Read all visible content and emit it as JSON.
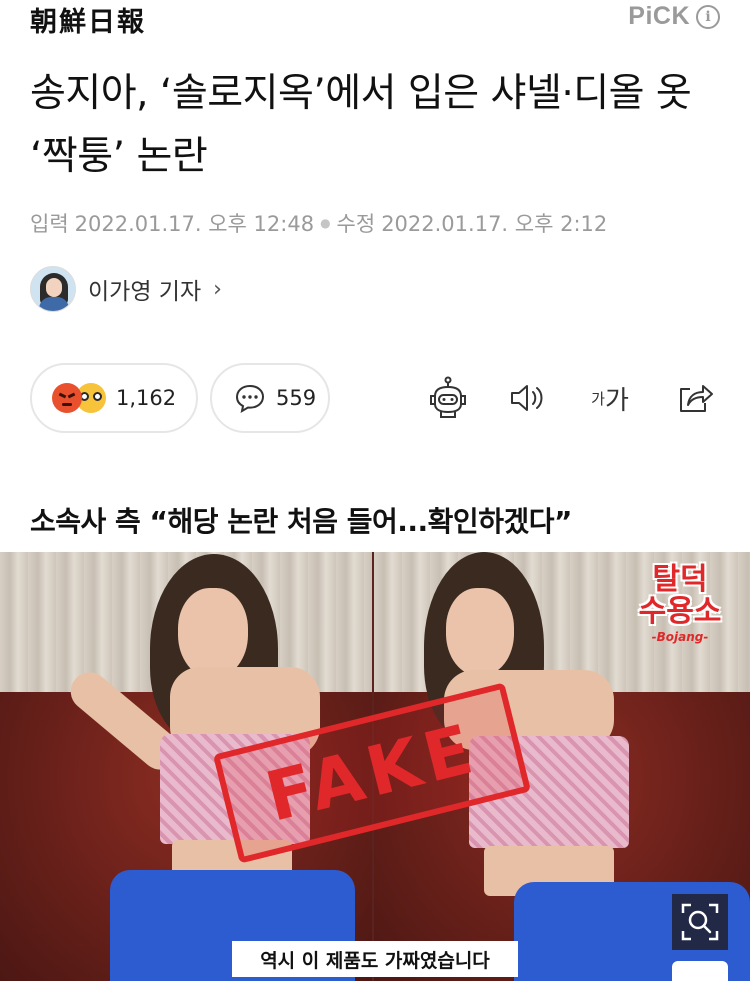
{
  "header": {
    "logo": "朝鮮日報",
    "pick_label": "PiCK",
    "info_icon": "info-icon"
  },
  "article": {
    "title": "송지아, ‘솔로지옥’에서 입은 샤넬·디올 옷 ‘짝퉁’ 논란",
    "published_label": "입력",
    "published_time": "2022.01.17. 오후 12:48",
    "modified_label": "수정",
    "modified_time": "2022.01.17. 오후 2:12",
    "reporter": "이가영 기자",
    "subheading": "소속사 측 “해당 논란 처음 들어...확인하겠다”"
  },
  "actions": {
    "reaction_count": "1,162",
    "comment_count": "559",
    "font_small": "가",
    "font_big": "가",
    "icons": [
      "angry-emoji-icon",
      "shocked-emoji-icon",
      "comment-icon",
      "robot-icon",
      "speaker-icon",
      "share-icon"
    ]
  },
  "photo": {
    "stamp": "FAKE",
    "show_logo_line1": "탈덕",
    "show_logo_line2": "수용소",
    "show_logo_sub": "-Bojang-",
    "caption": "역시 이 제품도 가짜였습니다",
    "zoom_icon": "zoom-icon"
  },
  "colors": {
    "stamp_red": "#e0282a",
    "muted_gray": "#9a9a9a",
    "angry_orange": "#e8502e",
    "emoji_yellow": "#f6c33a"
  }
}
